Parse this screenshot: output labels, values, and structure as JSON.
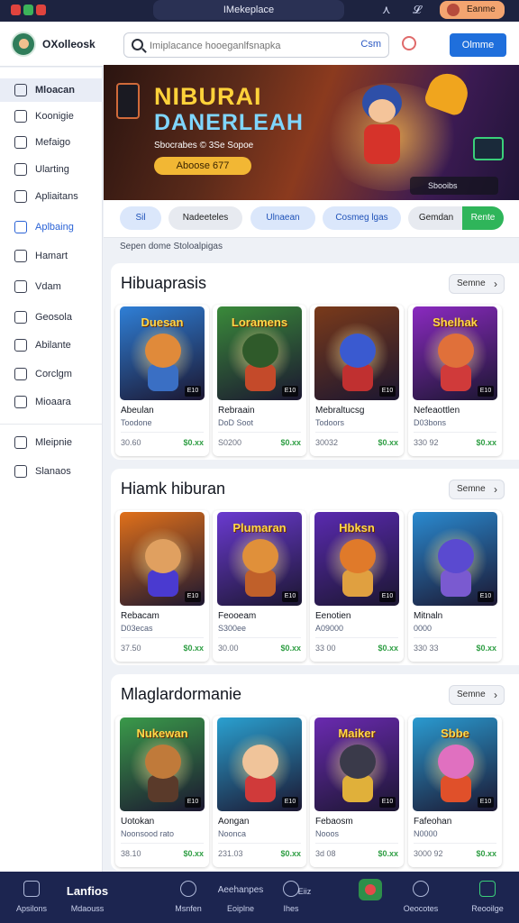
{
  "window": {
    "title": "IMekeplace"
  },
  "topbar": {
    "account_label": "Eanme"
  },
  "header": {
    "brand": "OXolleosk",
    "search_placeholder": "Imiplacance hooeganlfsnapka",
    "search_button": "Csm",
    "action_button": "Olmme"
  },
  "sidebar": {
    "items": [
      {
        "label": "Mloacan"
      },
      {
        "label": "Koonigie"
      },
      {
        "label": "Mefaigo"
      },
      {
        "label": "Ularting"
      },
      {
        "label": "Apliaitans"
      },
      {
        "label": "Aplbaing"
      },
      {
        "label": "Hamart"
      },
      {
        "label": "Vdam"
      },
      {
        "label": "Geosola"
      },
      {
        "label": "Abilante"
      },
      {
        "label": "Corclgm"
      },
      {
        "label": "Mioaara"
      },
      {
        "label": "Mleipnie"
      },
      {
        "label": "Slanaos"
      }
    ]
  },
  "banner": {
    "title_line1": "NIBURAI",
    "title_line2": "DANERLEAH",
    "subtitle": "Sbocrabes © 3Se Sopoe",
    "cta": "Aboose 677",
    "control_label": "Sbooibs"
  },
  "chips": [
    {
      "label": "Sil"
    },
    {
      "label": "Nadeeteles"
    },
    {
      "label": "Ulnaean"
    },
    {
      "label": "Cosmeg lgas"
    },
    {
      "label": "Gemdan"
    },
    {
      "label": "Rente"
    }
  ],
  "breadcrumb": "Sepen dome Stoloalpigas",
  "sections": [
    {
      "title": "Hibuaprasis",
      "button": "Semne",
      "cards": [
        {
          "art": "Duesan",
          "rating": "E10",
          "name": "Abeulan",
          "sub": "Toodone",
          "price": "30.60",
          "deal": "$0.xx",
          "theme": "#2f7fd6",
          "char": "#e08a3a",
          "body": "#3a6fc4"
        },
        {
          "art": "Loramens",
          "rating": "E10",
          "name": "Rebraain",
          "sub": "DoD Soot",
          "price": "S0200",
          "deal": "$0.xx",
          "theme": "#3a8a3a",
          "char": "#2f5a2a",
          "body": "#c44a2a"
        },
        {
          "art": "",
          "rating": "E10",
          "name": "Mebraltucsg",
          "sub": "Todoors",
          "price": "30032",
          "deal": "$0.xx",
          "theme": "#7a3a1a",
          "char": "#3a5ad0",
          "body": "#c03030"
        },
        {
          "art": "Shelhak",
          "rating": "E10",
          "name": "Nefeaottlen",
          "sub": "D03bons",
          "price": "330 92",
          "deal": "$0.xx",
          "theme": "#8a2ac0",
          "char": "#e0703a",
          "body": "#d03a3a"
        }
      ]
    },
    {
      "title": "Hiamk hiburan",
      "button": "Semne",
      "cards": [
        {
          "art": "",
          "rating": "E10",
          "name": "Rebacam",
          "sub": "D03ecas",
          "price": "37.50",
          "deal": "$0.xx",
          "theme": "#e0701a",
          "char": "#e0a060",
          "body": "#4a3ad0"
        },
        {
          "art": "Plumaran",
          "rating": "E10",
          "name": "Feooeam",
          "sub": "S300ee",
          "price": "30.00",
          "deal": "$0.xx",
          "theme": "#6a3ad0",
          "char": "#e0903a",
          "body": "#c0602a"
        },
        {
          "art": "Hbksn",
          "rating": "E10",
          "name": "Eenotien",
          "sub": "A09000",
          "price": "33 00",
          "deal": "$0.xx",
          "theme": "#5a2ab0",
          "char": "#e07a2a",
          "body": "#e0a040"
        },
        {
          "art": "",
          "rating": "E10",
          "name": "Mitnaln",
          "sub": "0000",
          "price": "330 33",
          "deal": "$0.xx",
          "theme": "#2a8ad0",
          "char": "#5a4ad0",
          "body": "#7a5ad0"
        }
      ]
    },
    {
      "title": "Mlaglardormanie",
      "button": "Semne",
      "cards": [
        {
          "art": "Nukewan",
          "rating": "E10",
          "name": "Uotokan",
          "sub": "Noonsood rato",
          "price": "38.10",
          "deal": "$0.xx",
          "theme": "#3a9a4a",
          "char": "#c07a3a",
          "body": "#5a3a2a"
        },
        {
          "art": "",
          "rating": "E10",
          "name": "Aongan",
          "sub": "Noonca",
          "price": "231.03",
          "deal": "$0.xx",
          "theme": "#2aa0d0",
          "char": "#f0c49a",
          "body": "#d03a3a"
        },
        {
          "art": "Maiker",
          "rating": "E10",
          "name": "Febaosm",
          "sub": "Nooos",
          "price": "3d 08",
          "deal": "$0.xx",
          "theme": "#6a2ab0",
          "char": "#3a3a4a",
          "body": "#e0b03a"
        },
        {
          "art": "Sbbe",
          "rating": "E10",
          "name": "Fafeohan",
          "sub": "N0000",
          "price": "3000 92",
          "deal": "$0.xx",
          "theme": "#2a9ad0",
          "char": "#e070c0",
          "body": "#e0502a"
        }
      ]
    }
  ],
  "bottomnav": {
    "items": [
      {
        "label": "Apsilons"
      },
      {
        "label": "Mdaouss",
        "top": "Lanfios"
      },
      {
        "label": "Msnfen"
      },
      {
        "label": "Eoiplne",
        "top": "Aeehanpes"
      },
      {
        "label": "Ihes",
        "top": "Eiiz"
      },
      {
        "label": ""
      },
      {
        "label": "Oeocotes"
      },
      {
        "label": "Reooilge"
      }
    ]
  },
  "colors": {
    "accent": "#1f6fdc",
    "topbar": "#1d2340",
    "bottomnav": "#1c2550",
    "deal": "#2f9e44"
  }
}
